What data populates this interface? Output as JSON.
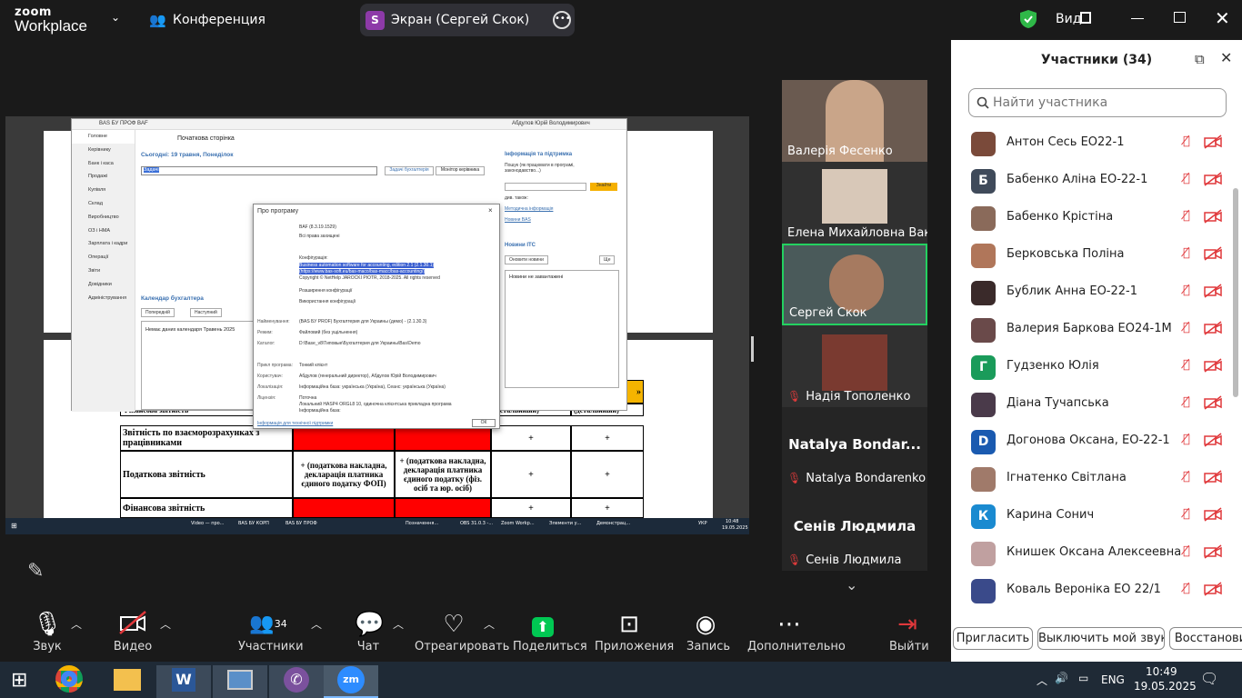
{
  "zoom": {
    "logo_line1": "zoom",
    "logo_line2": "Workplace",
    "meeting_label": "Конференция",
    "share_badge": "S",
    "share_label": "Экран (Сергей Скок)",
    "view_label": "Вид"
  },
  "shared_app": {
    "title": "BAS БУ ПРОФ BAF",
    "user": "Абдулов Юрій Володимирович",
    "nav": [
      "Головне",
      "Керівнику",
      "Банк і каса",
      "Продажі",
      "Купівля",
      "Склад",
      "Виробництво",
      "ОЗ і НМА",
      "Зарплата і кадри",
      "Операції",
      "Звіти",
      "Довідники",
      "Адміністрування"
    ],
    "page_title": "Початкова сторінка",
    "today": "Сьогодні: 19 травня, Понеділок",
    "tasks_input": "Задачі",
    "btn_tasks": "Задачі бухгалтерія",
    "btn_monitor": "Монітор керівника",
    "calendar_title": "Календар бухгалтера",
    "calendar_prev": "Попередній",
    "calendar_next": "Наступний",
    "calendar_empty": "Немає даних календаря Травень 2025",
    "info_title": "Інформація та підтримка",
    "info_search": "Пошук (як працювати в програмі, законодавство...)",
    "info_find": "Знайти",
    "info_see_also": "див. також:",
    "info_link1": "Методична інформація",
    "info_link2": "Новини BAS",
    "news_title": "Новини ІТС",
    "news_refresh": "Оновити новини",
    "news_more": "Ще",
    "news_empty": "Новини не завантажені",
    "about": {
      "title": "Про програму",
      "product": "BAF (8.3.19.1529)",
      "rights": "Всі права захищені",
      "config_label": "Конфігурація:",
      "config_line1": "Business automation software for accounting, edition 2.1 (2.1.30.1)",
      "config_line2": "(https://www.bas-soft.eu/bas-maco/bas-macc/bas-accounting/)",
      "copyright": "Copyright © NetHelp JAROCKI PIOTR, 2018-2025. All rights reserved",
      "ext_conf": "Розширення конфігурації",
      "use_conf": "Використання конфігурації",
      "k1": "Найменування:",
      "v1": "(BAS БУ PROF) Бухгалтерия для Украины (демо) - (2.1.30.3)",
      "k2": "Режим:",
      "v2": "Файловий (без ущільнення)",
      "k3": "Каталог:",
      "v3": "D:\\Base_v8\\Типовые\\Бухгалтерия для Украины\\Bas\\Demo",
      "k4": "Прикл програма:",
      "v4": "Тонкий клієнт",
      "k5": "Користувач:",
      "v5": "Абдулов (генеральний директор), Абдулов Юрій Володимирович",
      "k6": "Локалізація:",
      "v6": "Інформаційна база: українська (Україна), Сеанс: українська (Україна)",
      "k7": "Ліцензія:",
      "v7": "Поточна",
      "v8": "Локальний HASP4 ORGL8 10, одиночна клієнтська прикладна програма",
      "v9": "Інформаційна база:",
      "support_link": "Інформація для технічної підтримки",
      "ok": "ОК"
    },
    "table": {
      "row1": "Фінансова звітність",
      "row2": "Звітність по взаєморозрахунках з працівниками",
      "row3": "Податкова звітність",
      "row4": "Фінансова звітність",
      "tax_col1": "+ (податкова накладна, декларація платника єдиного податку ФОП)",
      "tax_col2": "+ (податкова накладна, декларація платника єдиного податку (фіз. осіб та юр. осіб)",
      "plus": "+",
      "hdr_a": "(детальниый)",
      "hdr_b": "(детальниый)"
    },
    "inner_taskbar": [
      "Video — про...",
      "BAS БУ КОРП",
      "BAS БУ ПРОФ",
      "",
      "Позначення...",
      "OBS 31.0.3 -...",
      "Zoom Workp...",
      "Элементи у...",
      "Демонстрац..."
    ],
    "inner_clock": "10:48",
    "inner_date": "19.05.2025",
    "inner_lang": "УКР"
  },
  "gallery": [
    {
      "name": "Валерія Фесенко",
      "muted": false
    },
    {
      "name": "Елена Михайловна Ваку...",
      "muted": false
    },
    {
      "name": "Сергей Скок",
      "muted": false,
      "active": true
    },
    {
      "name": "Надія Тополенко",
      "muted": true
    },
    {
      "name": "Natalya Bondarenko",
      "big": "Natalya Bondar...",
      "muted": true
    },
    {
      "name": "Сенів Людмила",
      "big": "Сенів Людмила",
      "muted": true
    }
  ],
  "panel": {
    "title": "Участники (34)",
    "search_placeholder": "Найти участника",
    "participants": [
      {
        "initial": "",
        "name": "Антон Сесь ЕО22-1",
        "color": "#7a4a3a"
      },
      {
        "initial": "Б",
        "name": "Бабенко Аліна ЕО-22-1",
        "color": "#3f4a5a"
      },
      {
        "initial": "",
        "name": "Бабенко Крістіна",
        "color": "#8a6a5a"
      },
      {
        "initial": "",
        "name": "Берковська Поліна",
        "color": "#b0765a"
      },
      {
        "initial": "",
        "name": "Бублик Анна ЕО-22-1",
        "color": "#3a2a2a"
      },
      {
        "initial": "",
        "name": "Валерия Баркова ЕО24-1М",
        "color": "#6a4a4a"
      },
      {
        "initial": "Г",
        "name": "Гудзенко Юлія",
        "color": "#1a9b5a"
      },
      {
        "initial": "",
        "name": "Діана Тучапська",
        "color": "#4a3a4a"
      },
      {
        "initial": "D",
        "name": "Догонова Оксана, ЕО-22-1",
        "color": "#1a5ab0"
      },
      {
        "initial": "",
        "name": "Ігнатенко Світлана",
        "color": "#a07a6a"
      },
      {
        "initial": "К",
        "name": "Карина Сонич",
        "color": "#1a8ad0"
      },
      {
        "initial": "",
        "name": "Книшек Оксана Алексеевна",
        "color": "#c0a0a0"
      },
      {
        "initial": "",
        "name": "Коваль Вероніка ЕО 22/1",
        "color": "#3a4a8a"
      }
    ],
    "btn_invite": "Пригласить",
    "btn_mute": "Выключить мой звук",
    "btn_restore": "Восстанови"
  },
  "toolbar": {
    "audio": "Звук",
    "video": "Видео",
    "participants": "Участники",
    "participants_count": "34",
    "chat": "Чат",
    "react": "Отреагировать",
    "share": "Поделиться",
    "apps": "Приложения",
    "record": "Запись",
    "more": "Дополнительно",
    "leave": "Выйти"
  },
  "windows": {
    "lang": "ENG",
    "time": "10:49",
    "date": "19.05.2025"
  },
  "colors": {
    "zoom_dark": "#1a1a1a",
    "share_green": "#00c853",
    "active_tile": "#23d160",
    "muted_red": "#e0383b"
  }
}
